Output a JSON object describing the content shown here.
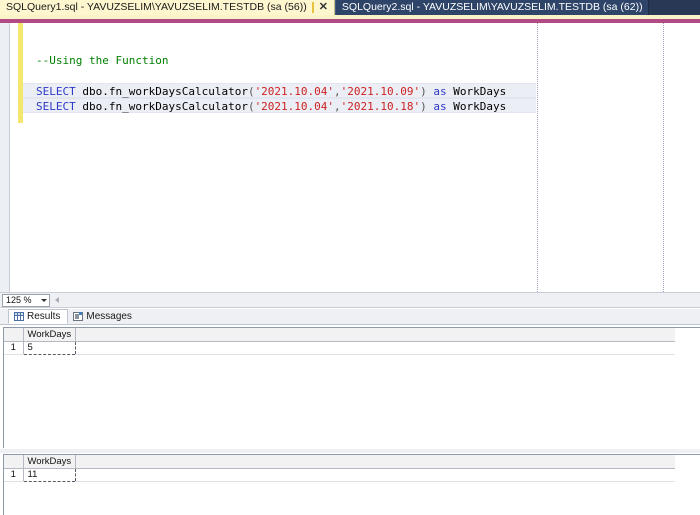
{
  "window": {
    "tabs": [
      {
        "title": "SQLQuery1.sql - YAVUZSELIM\\YAVUZSELIM.TESTDB (sa (56))",
        "active": true,
        "close_label": "✕"
      },
      {
        "title": "SQLQuery2.sql - YAVUZSELIM\\YAVUZSELIM.TESTDB (sa (62))",
        "active": false
      }
    ]
  },
  "editor": {
    "lines": [
      {
        "indent": 0,
        "tokens": []
      },
      {
        "indent": 0,
        "tokens": []
      },
      {
        "indent": 0,
        "tokens": [
          {
            "t": "comment",
            "s": "--Using the Function"
          }
        ]
      },
      {
        "indent": 0,
        "tokens": []
      },
      {
        "indent": 0,
        "selected": true,
        "tokens": [
          {
            "t": "keyword",
            "s": "SELECT"
          },
          {
            "t": "plain",
            "s": " dbo.fn_workDaysCalculator"
          },
          {
            "t": "paren",
            "s": "("
          },
          {
            "t": "string",
            "s": "'2021.10.04'"
          },
          {
            "t": "paren",
            "s": ","
          },
          {
            "t": "string",
            "s": "'2021.10.09'"
          },
          {
            "t": "paren",
            "s": ")"
          },
          {
            "t": "plain",
            "s": " "
          },
          {
            "t": "keyword",
            "s": "as"
          },
          {
            "t": "plain",
            "s": " WorkDays"
          }
        ]
      },
      {
        "indent": 0,
        "selected": true,
        "tokens": [
          {
            "t": "keyword",
            "s": "SELECT"
          },
          {
            "t": "plain",
            "s": " dbo.fn_workDaysCalculator"
          },
          {
            "t": "paren",
            "s": "("
          },
          {
            "t": "string",
            "s": "'2021.10.04'"
          },
          {
            "t": "paren",
            "s": ","
          },
          {
            "t": "string",
            "s": "'2021.10.18'"
          },
          {
            "t": "paren",
            "s": ")"
          },
          {
            "t": "plain",
            "s": " "
          },
          {
            "t": "keyword",
            "s": "as"
          },
          {
            "t": "plain",
            "s": " WorkDays"
          }
        ]
      }
    ]
  },
  "zoom_bar": {
    "zoom_level": "125 %"
  },
  "results_tabs": [
    {
      "label": "Results",
      "icon": "grid-icon",
      "active": true
    },
    {
      "label": "Messages",
      "icon": "messages-icon",
      "active": false
    }
  ],
  "result_grids": [
    {
      "columns": [
        "WorkDays"
      ],
      "rows": [
        {
          "row_number": "1",
          "values": [
            "5"
          ]
        }
      ]
    },
    {
      "columns": [
        "WorkDays"
      ],
      "rows": [
        {
          "row_number": "1",
          "values": [
            "11"
          ]
        }
      ]
    }
  ]
}
